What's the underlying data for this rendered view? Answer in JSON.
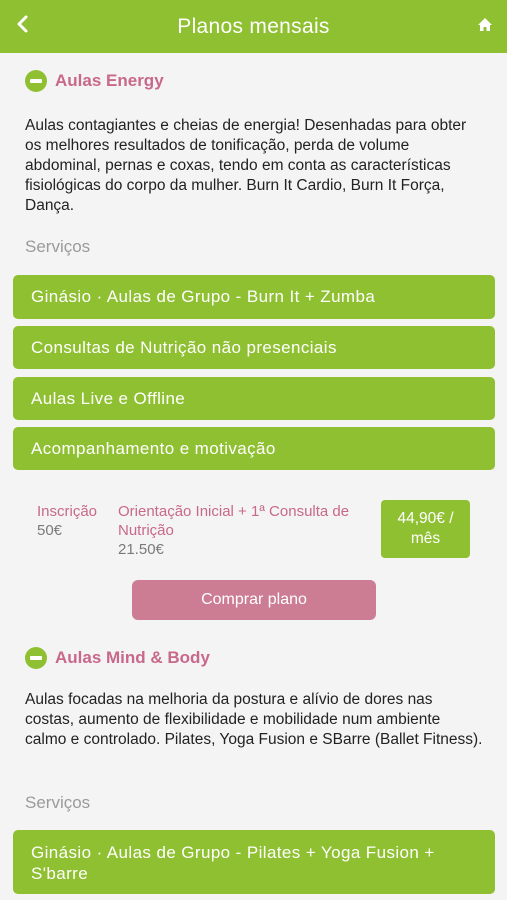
{
  "header": {
    "title": "Planos mensais",
    "back_icon": "chevron-left-icon",
    "home_icon": "home-icon",
    "bg_color": "#8fc031"
  },
  "plans": [
    {
      "title": "Aulas Energy",
      "description": "Aulas contagiantes e cheias de energia! Desenhadas para obter os melhores resultados de tonificação, perda de volume abdominal, pernas e coxas, tendo em conta as características fisiológicas do corpo da mulher. Burn It Cardio, Burn It Força, Dança.",
      "services_label": "Serviços",
      "services": [
        "Ginásio · Aulas de Grupo - Burn It + Zumba",
        "Consultas de Nutrição não presenciais",
        "Aulas Live e Offline",
        "Acompanhamento e motivação"
      ],
      "fees": [
        {
          "label": "Inscrição",
          "value": "50€"
        },
        {
          "label": "Orientação Inicial + 1ª Consulta de Nutrição",
          "value": "21.50€"
        }
      ],
      "price": "44,90€ /",
      "price_unit": "mês",
      "buy_label": "Comprar plano"
    },
    {
      "title": "Aulas Mind & Body",
      "description": "Aulas focadas na melhoria da postura e alívio de dores nas costas, aumento de flexibilidade e mobilidade num ambiente calmo e controlado. Pilates, Yoga Fusion e SBarre (Ballet Fitness).",
      "services_label": "Serviços",
      "services": [
        "Ginásio · Aulas de Grupo - Pilates + Yoga Fusion + S'barre"
      ]
    }
  ],
  "colors": {
    "accent_green": "#8fc031",
    "accent_pink": "#c8688a",
    "button_pink": "#cc7d94"
  }
}
